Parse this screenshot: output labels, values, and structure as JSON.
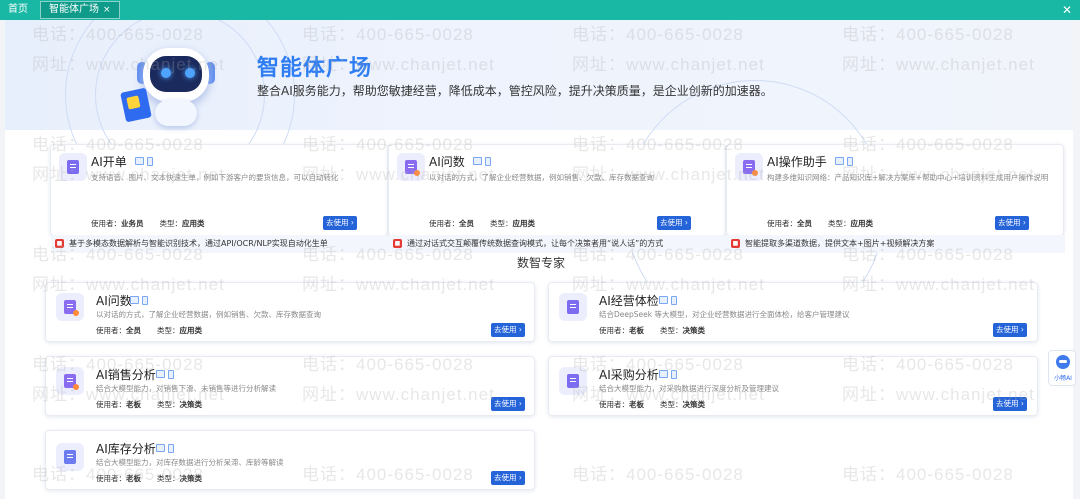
{
  "topbar": {
    "tabs": [
      {
        "label": "首页"
      },
      {
        "label": "智能体广场",
        "close": "×"
      }
    ],
    "close_glyph": "✕"
  },
  "banner": {
    "title": "智能体广场",
    "subtitle": "整合AI服务能力，帮助您敏捷经营，降低成本，管控风险，提升决策质量，是企业创新的加速器。"
  },
  "feature_cards": [
    {
      "title": "AI开单",
      "desc": "支持语音、图片、文本快速生单，例如下游客户的要货信息，可以自动转化",
      "user_label": "使用者：",
      "user": "业务员",
      "type_label": "类型：",
      "type": "应用类",
      "button": "去使用",
      "note": "基于多模态数据解析与智能识别技术，通过API/OCR/NLP实现自动化生单"
    },
    {
      "title": "AI问数",
      "desc": "以对话的方式，了解企业经营数据，例如销售、欠款、库存数据查询",
      "user_label": "使用者：",
      "user": "全员",
      "type_label": "类型：",
      "type": "应用类",
      "button": "去使用",
      "note": "通过对话式交互颠覆传统数据查询模式，让每个决策者用“说人话”的方式"
    },
    {
      "title": "AI操作助手",
      "desc": "构建多维知识网络：产品知识库+解决方案库+帮助中心+培训资料生成用户操作说明",
      "user_label": "使用者：",
      "user": "全员",
      "type_label": "类型：",
      "type": "应用类",
      "button": "去使用",
      "note": "智能提取多渠道数据，提供文本+图片+视频解决方案"
    }
  ],
  "section": {
    "title": "数智专家"
  },
  "expert_cards": [
    {
      "title": "AI问数",
      "desc": "以对话的方式，了解企业经营数据，例如销售、欠款、库存数据查询",
      "user_label": "使用者：",
      "user": "全员",
      "type_label": "类型：",
      "type": "应用类",
      "button": "去使用"
    },
    {
      "title": "AI经营体检",
      "desc": "结合DeepSeek 等大模型，对企业经营数据进行全面体检，给客户管理建议",
      "user_label": "使用者：",
      "user": "老板",
      "type_label": "类型：",
      "type": "决策类",
      "button": "去使用"
    },
    {
      "title": "AI销售分析",
      "desc": "结合大模型能力，对销售下滑、未销售等进行分析解读",
      "user_label": "使用者：",
      "user": "老板",
      "type_label": "类型：",
      "type": "决策类",
      "button": "去使用"
    },
    {
      "title": "AI采购分析",
      "desc": "结合大模型能力，对采购数据进行深度分析及管理建议",
      "user_label": "使用者：",
      "user": "老板",
      "type_label": "类型：",
      "type": "决策类",
      "button": "去使用"
    },
    {
      "title": "AI库存分析",
      "desc": "结合大模型能力，对库存数据进行分析呆滞、库龄等解读",
      "user_label": "使用者：",
      "user": "老板",
      "type_label": "类型：",
      "type": "决策类",
      "button": "去使用"
    }
  ],
  "side_widget": {
    "label": "小畅AI"
  },
  "watermark": {
    "phone": "电话：400-665-0028",
    "site": "网址：www.chanjet.net"
  },
  "colors": {
    "topbar": "#18b8a5",
    "accent": "#2563d9",
    "banner_title": "#2f7df2"
  }
}
